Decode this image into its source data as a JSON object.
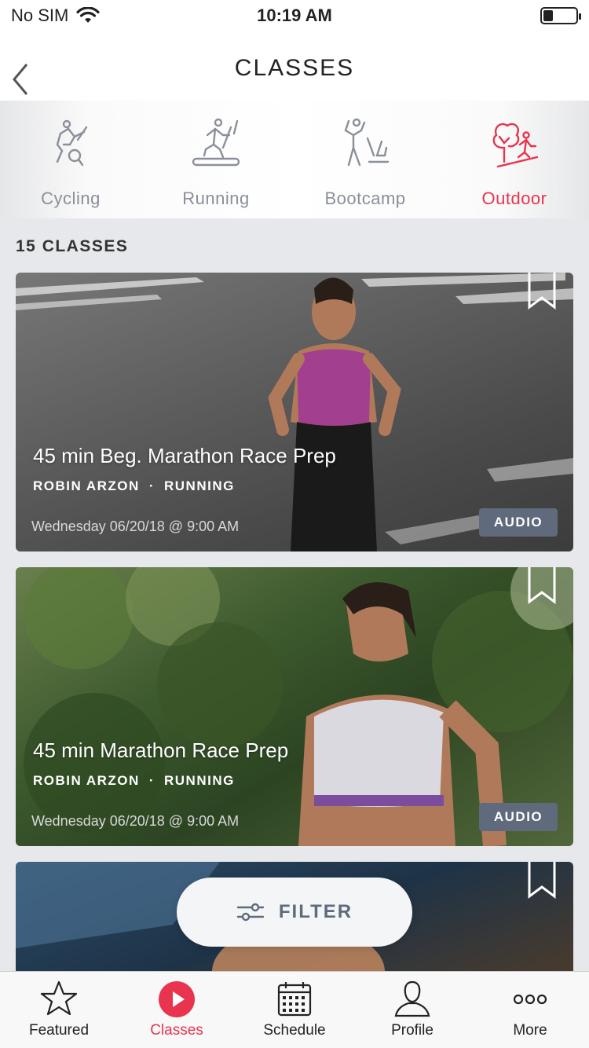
{
  "status": {
    "carrier": "No SIM",
    "time": "10:19 AM",
    "battery_level": 0.3
  },
  "nav": {
    "title": "CLASSES"
  },
  "categories": [
    {
      "label": "Cycling",
      "icon": "cycling-icon",
      "active": false
    },
    {
      "label": "Running",
      "icon": "running-icon",
      "active": false
    },
    {
      "label": "Bootcamp",
      "icon": "bootcamp-icon",
      "active": false
    },
    {
      "label": "Outdoor",
      "icon": "outdoor-icon",
      "active": true
    }
  ],
  "list": {
    "count_label": "15 CLASSES"
  },
  "classes": [
    {
      "title": "45 min Beg. Marathon Race Prep",
      "instructor": "ROBIN ARZON",
      "separator": "·",
      "type": "RUNNING",
      "date": "Wednesday 06/20/18 @ 9:00 AM",
      "badge": "AUDIO"
    },
    {
      "title": "45 min Marathon Race Prep",
      "instructor": "ROBIN ARZON",
      "separator": "·",
      "type": "RUNNING",
      "date": "Wednesday 06/20/18 @ 9:00 AM",
      "badge": "AUDIO"
    }
  ],
  "filter": {
    "label": "FILTER"
  },
  "tabbar": [
    {
      "label": "Featured",
      "icon": "star-icon",
      "active": false
    },
    {
      "label": "Classes",
      "icon": "play-icon",
      "active": true
    },
    {
      "label": "Schedule",
      "icon": "calendar-icon",
      "active": false
    },
    {
      "label": "Profile",
      "icon": "person-icon",
      "active": false
    },
    {
      "label": "More",
      "icon": "more-icon",
      "active": false
    }
  ],
  "colors": {
    "accent": "#e8344e",
    "muted": "#8a8f99",
    "badge": "#5f6b7c"
  }
}
